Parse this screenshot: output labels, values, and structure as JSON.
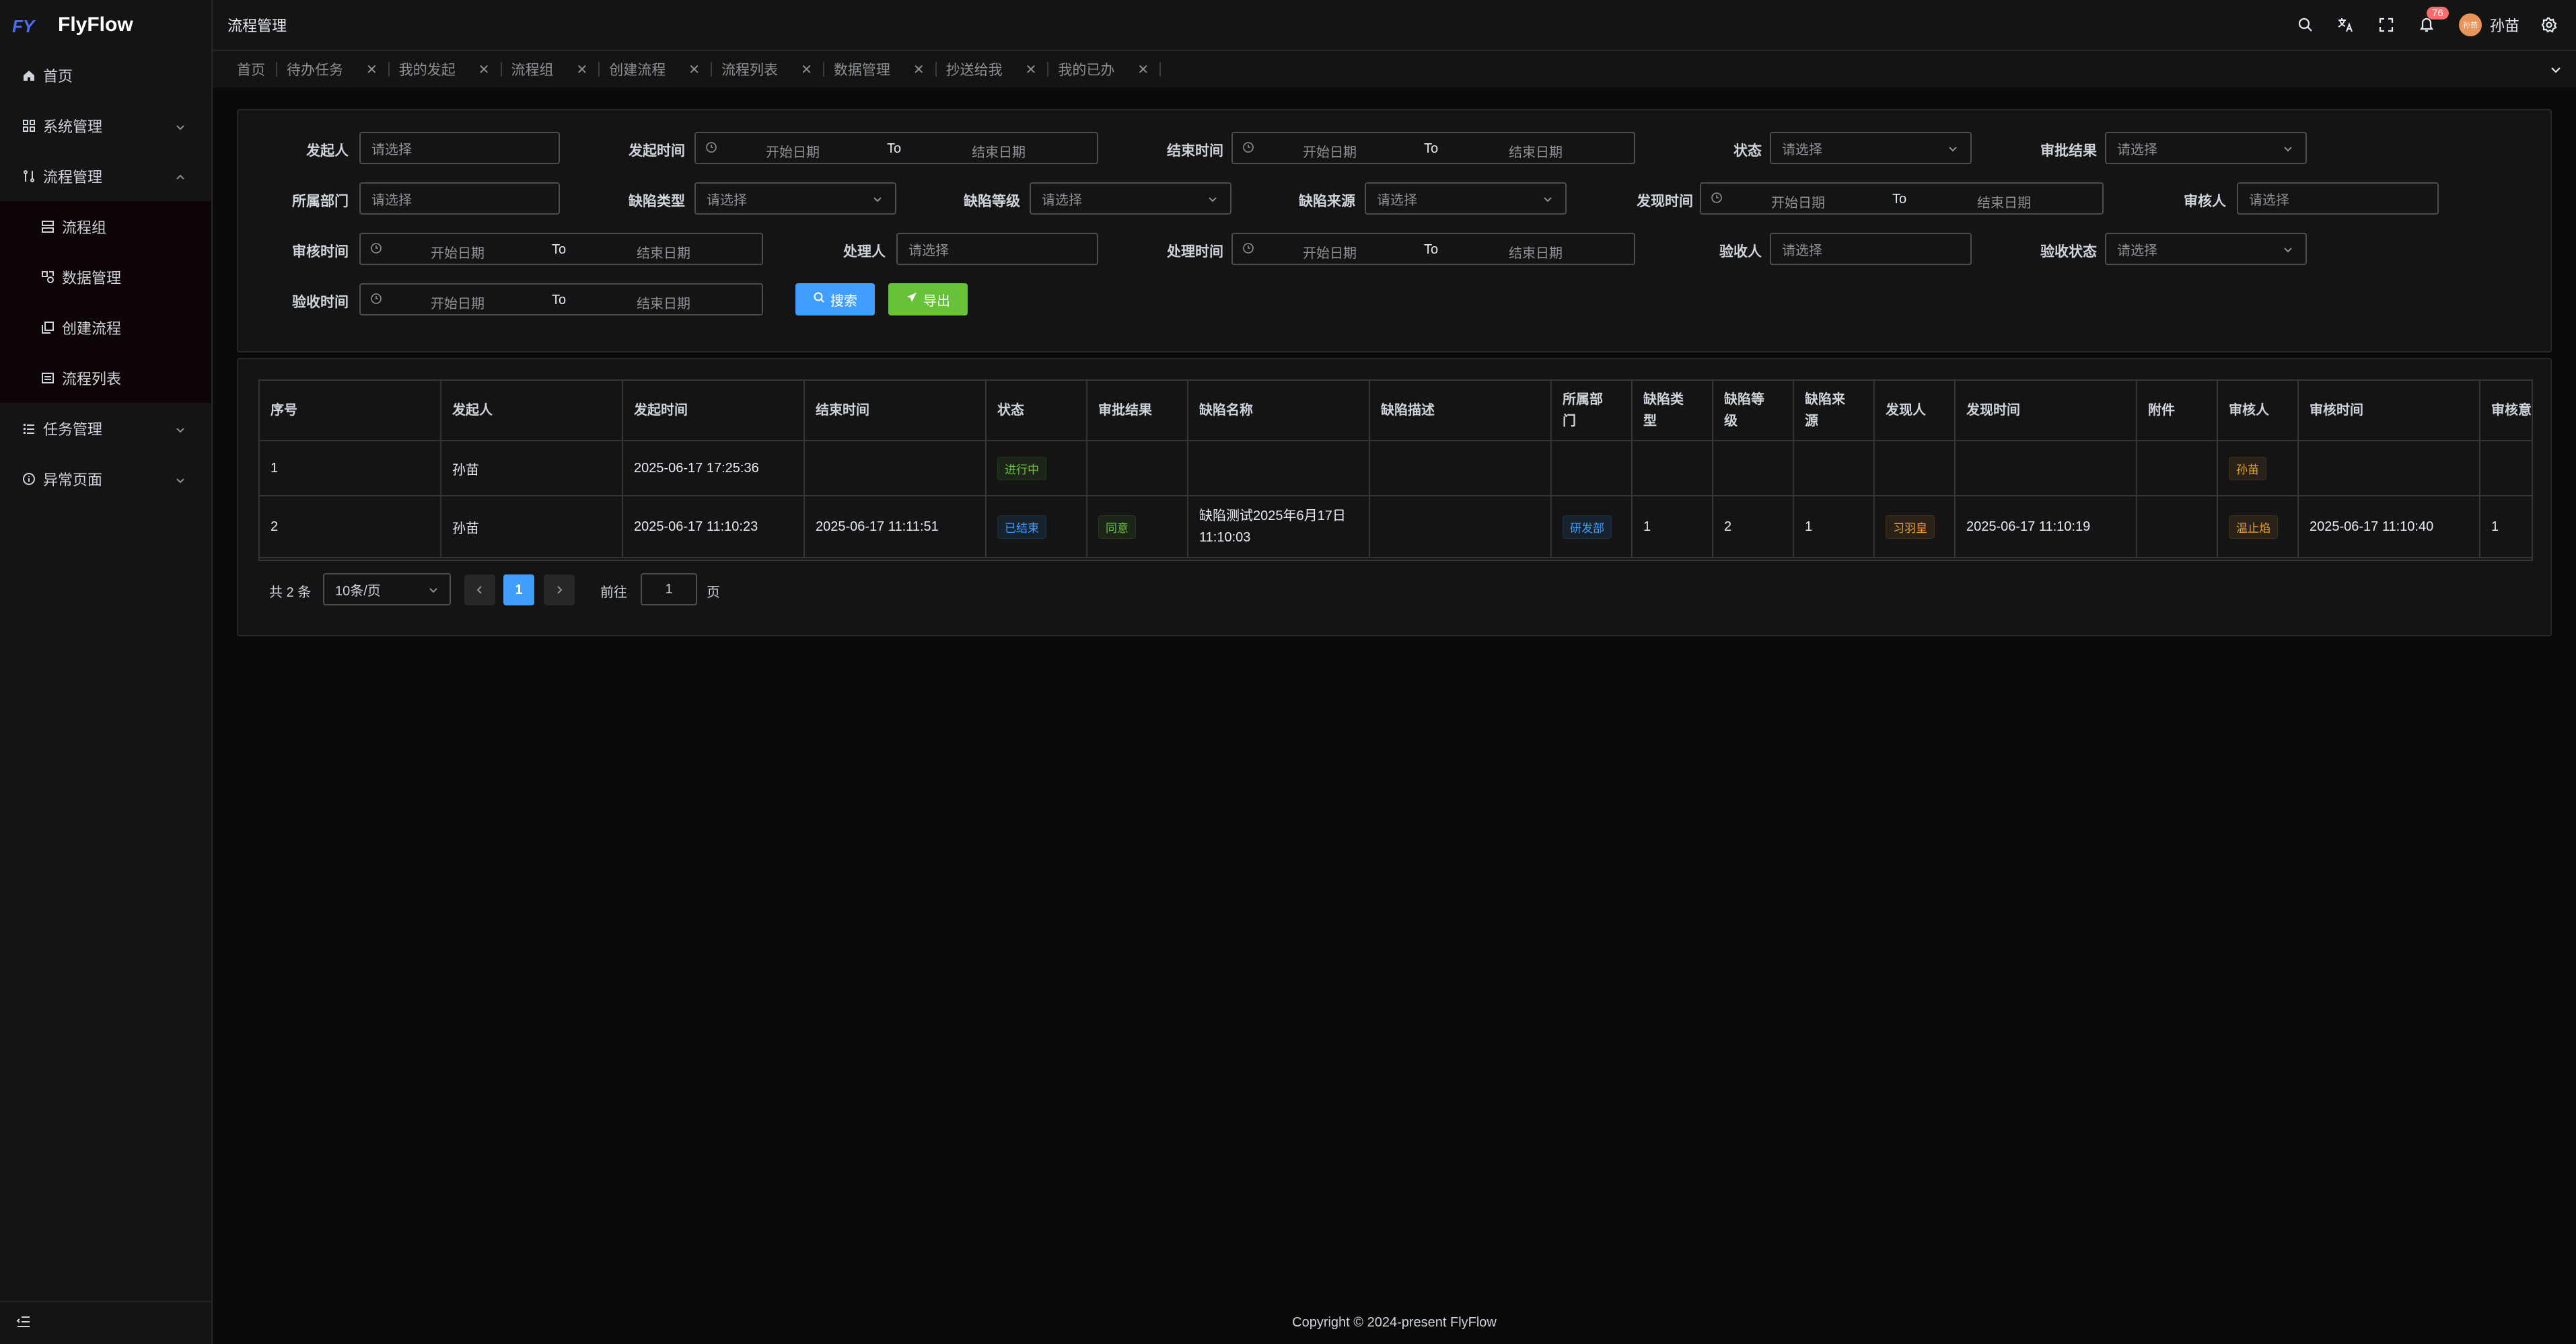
{
  "app": {
    "name": "FlyFlow",
    "logo_mark": "FY"
  },
  "sidebar": {
    "items": [
      {
        "label": "首页",
        "icon": "home-icon"
      },
      {
        "label": "系统管理",
        "icon": "grid-icon"
      },
      {
        "label": "流程管理",
        "icon": "flow-icon"
      },
      {
        "label": "任务管理",
        "icon": "list-icon"
      },
      {
        "label": "异常页面",
        "icon": "info-icon"
      }
    ],
    "sub_items": [
      {
        "label": "流程组"
      },
      {
        "label": "数据管理"
      },
      {
        "label": "创建流程"
      },
      {
        "label": "流程列表"
      }
    ]
  },
  "header": {
    "title": "流程管理",
    "notification_count": "76",
    "avatar_text": "孙苗",
    "username": "孙苗"
  },
  "tabs": [
    {
      "label": "首页"
    },
    {
      "label": "待办任务"
    },
    {
      "label": "我的发起"
    },
    {
      "label": "流程组"
    },
    {
      "label": "创建流程"
    },
    {
      "label": "流程列表"
    },
    {
      "label": "数据管理"
    },
    {
      "label": "抄送给我"
    },
    {
      "label": "我的已办"
    }
  ],
  "filters": {
    "placeholder_select": "请选择",
    "start_date": "开始日期",
    "end_date": "结束日期",
    "to": "To",
    "labels": {
      "initiator": "发起人",
      "start_time": "发起时间",
      "end_time": "结束时间",
      "status": "状态",
      "approval_result": "审批结果",
      "department": "所属部门",
      "defect_type": "缺陷类型",
      "defect_level": "缺陷等级",
      "defect_source": "缺陷来源",
      "discovery_time": "发现时间",
      "reviewer": "审核人",
      "review_time": "审核时间",
      "handler": "处理人",
      "handle_time": "处理时间",
      "acceptor": "验收人",
      "acceptance_status": "验收状态",
      "acceptance_time": "验收时间"
    },
    "search_button": "搜索",
    "export_button": "导出"
  },
  "table": {
    "columns": [
      "序号",
      "发起人",
      "发起时间",
      "结束时间",
      "状态",
      "审批结果",
      "缺陷名称",
      "缺陷描述",
      "所属部门",
      "缺陷类型",
      "缺陷等级",
      "缺陷来源",
      "发现人",
      "发现时间",
      "附件",
      "审核人",
      "审核时间",
      "审核意"
    ],
    "rows": [
      {
        "index": "1",
        "initiator": "孙苗",
        "start_time": "2025-06-17 17:25:36",
        "end_time": "",
        "status": "进行中",
        "result": "",
        "defect_name": "",
        "defect_desc": "",
        "dept": "",
        "type": "",
        "level": "",
        "source": "",
        "finder": "",
        "found_time": "",
        "attachment": "",
        "reviewer": "孙苗",
        "review_time": "",
        "review_opinion": ""
      },
      {
        "index": "2",
        "initiator": "孙苗",
        "start_time": "2025-06-17 11:10:23",
        "end_time": "2025-06-17 11:11:51",
        "status": "已结束",
        "result": "同意",
        "defect_name_1": "缺陷测试2025年6月17日",
        "defect_name_2": "11:10:03",
        "defect_desc": "",
        "dept": "研发部",
        "type": "1",
        "level": "2",
        "source": "1",
        "finder": "习羽皇",
        "found_time": "2025-06-17 11:10:19",
        "attachment": "",
        "reviewer": "温止焰",
        "review_time": "2025-06-17 11:10:40",
        "review_opinion": "1"
      }
    ]
  },
  "pagination": {
    "total": "共 2 条",
    "page_size": "10条/页",
    "current_page": "1",
    "goto_label": "前往",
    "goto_value": "1",
    "page_suffix": "页"
  },
  "footer": {
    "copyright": "Copyright © 2024-present FlyFlow"
  },
  "colors": {
    "accent": "#409eff",
    "success": "#67c23a",
    "warning": "#e6a23c",
    "danger": "#f56c6c",
    "bg": "#141414"
  }
}
